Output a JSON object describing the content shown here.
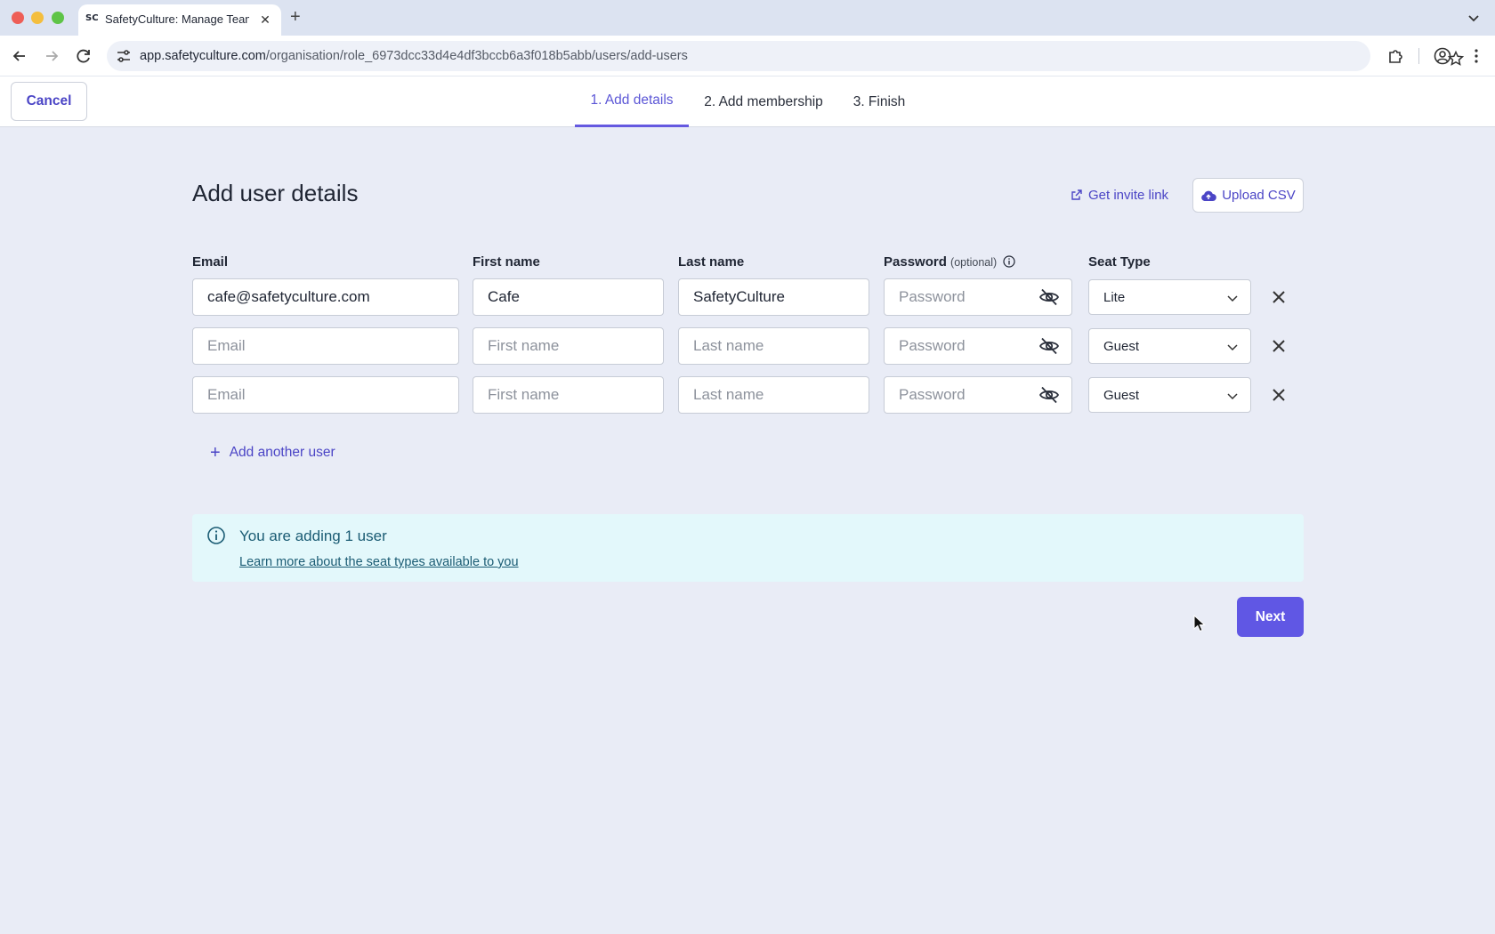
{
  "browser": {
    "tab_favicon": "SC",
    "tab_title": "SafetyCulture: Manage Teams",
    "url_host": "app.safetyculture.com",
    "url_path": "/organisation/role_6973dcc33d4e4df3bccb6a3f018b5abb/users/add-users"
  },
  "header": {
    "cancel_label": "Cancel",
    "steps": [
      {
        "label": "1. Add details",
        "active": true
      },
      {
        "label": "2. Add membership",
        "active": false
      },
      {
        "label": "3. Finish",
        "active": false
      }
    ]
  },
  "page": {
    "title": "Add user details",
    "invite_link_label": "Get invite link",
    "upload_csv_label": "Upload CSV"
  },
  "columns": {
    "email": "Email",
    "first_name": "First name",
    "last_name": "Last name",
    "password": "Password",
    "password_optional": "(optional)",
    "seat_type": "Seat Type"
  },
  "rows": [
    {
      "email": "cafe@safetyculture.com",
      "first_name": "Cafe",
      "last_name": "SafetyCulture",
      "password": "",
      "seat_type": "Lite"
    },
    {
      "email": "",
      "first_name": "",
      "last_name": "",
      "password": "",
      "seat_type": "Guest"
    },
    {
      "email": "",
      "first_name": "",
      "last_name": "",
      "password": "",
      "seat_type": "Guest"
    }
  ],
  "placeholders": {
    "email": "Email",
    "first_name": "First name",
    "last_name": "Last name",
    "password": "Password"
  },
  "add_user_label": "Add another user",
  "alert": {
    "title": "You are adding 1 user",
    "link": "Learn more about the seat types available to you"
  },
  "next_label": "Next",
  "colors": {
    "accent": "#6057e4",
    "link": "#4b45c6",
    "alert_bg": "#e3f8fb",
    "page_bg": "#e9ecf6"
  }
}
